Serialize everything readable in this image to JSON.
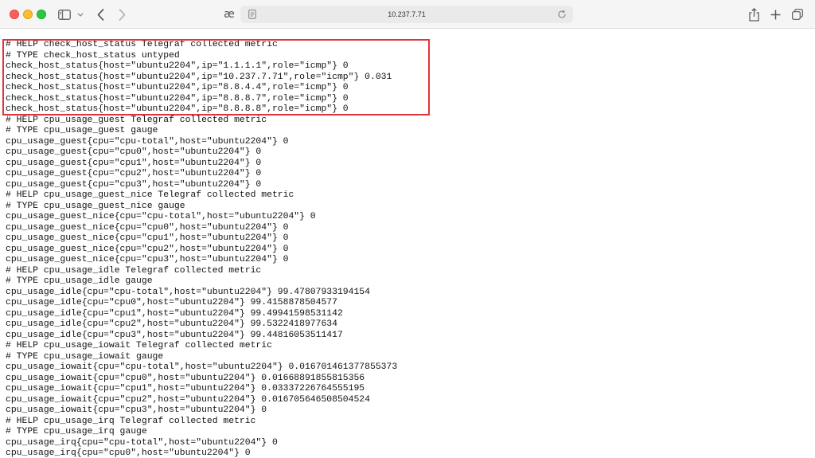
{
  "browser": {
    "url": "10.237.7.71",
    "translate_glyph": "æ",
    "icons": {
      "close": "close-window-control",
      "minimize": "minimize-window-control",
      "maximize": "maximize-window-control",
      "sidebar": "sidebar-icon",
      "chevron": "chevron-down-icon",
      "back": "back-arrow-icon",
      "forward": "forward-arrow-icon",
      "page": "page-icon",
      "reload": "reload-icon",
      "share": "share-icon",
      "new_tab": "plus-icon",
      "tabs": "tab-overview-icon"
    },
    "colors": {
      "close": "#fe5f57",
      "minimize": "#febc2e",
      "maximize": "#28c840",
      "highlight": "#e2333b"
    }
  },
  "metrics": [
    "# HELP check_host_status Telegraf collected metric",
    "# TYPE check_host_status untyped",
    "check_host_status{host=\"ubuntu2204\",ip=\"1.1.1.1\",role=\"icmp\"} 0",
    "check_host_status{host=\"ubuntu2204\",ip=\"10.237.7.71\",role=\"icmp\"} 0.031",
    "check_host_status{host=\"ubuntu2204\",ip=\"8.8.4.4\",role=\"icmp\"} 0",
    "check_host_status{host=\"ubuntu2204\",ip=\"8.8.8.7\",role=\"icmp\"} 0",
    "check_host_status{host=\"ubuntu2204\",ip=\"8.8.8.8\",role=\"icmp\"} 0",
    "# HELP cpu_usage_guest Telegraf collected metric",
    "# TYPE cpu_usage_guest gauge",
    "cpu_usage_guest{cpu=\"cpu-total\",host=\"ubuntu2204\"} 0",
    "cpu_usage_guest{cpu=\"cpu0\",host=\"ubuntu2204\"} 0",
    "cpu_usage_guest{cpu=\"cpu1\",host=\"ubuntu2204\"} 0",
    "cpu_usage_guest{cpu=\"cpu2\",host=\"ubuntu2204\"} 0",
    "cpu_usage_guest{cpu=\"cpu3\",host=\"ubuntu2204\"} 0",
    "# HELP cpu_usage_guest_nice Telegraf collected metric",
    "# TYPE cpu_usage_guest_nice gauge",
    "cpu_usage_guest_nice{cpu=\"cpu-total\",host=\"ubuntu2204\"} 0",
    "cpu_usage_guest_nice{cpu=\"cpu0\",host=\"ubuntu2204\"} 0",
    "cpu_usage_guest_nice{cpu=\"cpu1\",host=\"ubuntu2204\"} 0",
    "cpu_usage_guest_nice{cpu=\"cpu2\",host=\"ubuntu2204\"} 0",
    "cpu_usage_guest_nice{cpu=\"cpu3\",host=\"ubuntu2204\"} 0",
    "# HELP cpu_usage_idle Telegraf collected metric",
    "# TYPE cpu_usage_idle gauge",
    "cpu_usage_idle{cpu=\"cpu-total\",host=\"ubuntu2204\"} 99.47807933194154",
    "cpu_usage_idle{cpu=\"cpu0\",host=\"ubuntu2204\"} 99.4158878504577",
    "cpu_usage_idle{cpu=\"cpu1\",host=\"ubuntu2204\"} 99.49941598531142",
    "cpu_usage_idle{cpu=\"cpu2\",host=\"ubuntu2204\"} 99.5322418977634",
    "cpu_usage_idle{cpu=\"cpu3\",host=\"ubuntu2204\"} 99.44816053511417",
    "# HELP cpu_usage_iowait Telegraf collected metric",
    "# TYPE cpu_usage_iowait gauge",
    "cpu_usage_iowait{cpu=\"cpu-total\",host=\"ubuntu2204\"} 0.016701461377855373",
    "cpu_usage_iowait{cpu=\"cpu0\",host=\"ubuntu2204\"} 0.01668891855815356",
    "cpu_usage_iowait{cpu=\"cpu1\",host=\"ubuntu2204\"} 0.03337226764555195",
    "cpu_usage_iowait{cpu=\"cpu2\",host=\"ubuntu2204\"} 0.016705646508504524",
    "cpu_usage_iowait{cpu=\"cpu3\",host=\"ubuntu2204\"} 0",
    "# HELP cpu_usage_irq Telegraf collected metric",
    "# TYPE cpu_usage_irq gauge",
    "cpu_usage_irq{cpu=\"cpu-total\",host=\"ubuntu2204\"} 0",
    "cpu_usage_irq{cpu=\"cpu0\",host=\"ubuntu2204\"} 0"
  ]
}
